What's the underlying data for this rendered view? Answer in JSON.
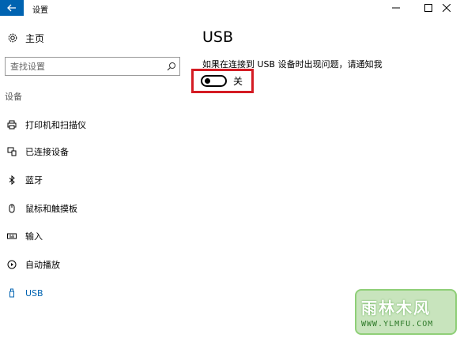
{
  "window": {
    "title": "设置"
  },
  "sidebar": {
    "home_label": "主页",
    "search_placeholder": "查找设置",
    "section_label": "设备",
    "items": [
      {
        "label": "打印机和扫描仪",
        "icon": "printer-icon"
      },
      {
        "label": "已连接设备",
        "icon": "connected-devices-icon"
      },
      {
        "label": "蓝牙",
        "icon": "bluetooth-icon"
      },
      {
        "label": "鼠标和触摸板",
        "icon": "mouse-icon"
      },
      {
        "label": "输入",
        "icon": "keyboard-icon"
      },
      {
        "label": "自动播放",
        "icon": "autoplay-icon"
      },
      {
        "label": "USB",
        "icon": "usb-icon",
        "active": true
      }
    ]
  },
  "main": {
    "title": "USB",
    "notify_description": "如果在连接到 USB 设备时出现问题，请通知我",
    "toggle": {
      "state_label": "关",
      "on": false
    }
  },
  "watermark": {
    "text": "雨林木风",
    "url": "WWW.YLMFU.COM"
  },
  "colors": {
    "accent": "#0063b1",
    "highlight": "#d41b23"
  }
}
